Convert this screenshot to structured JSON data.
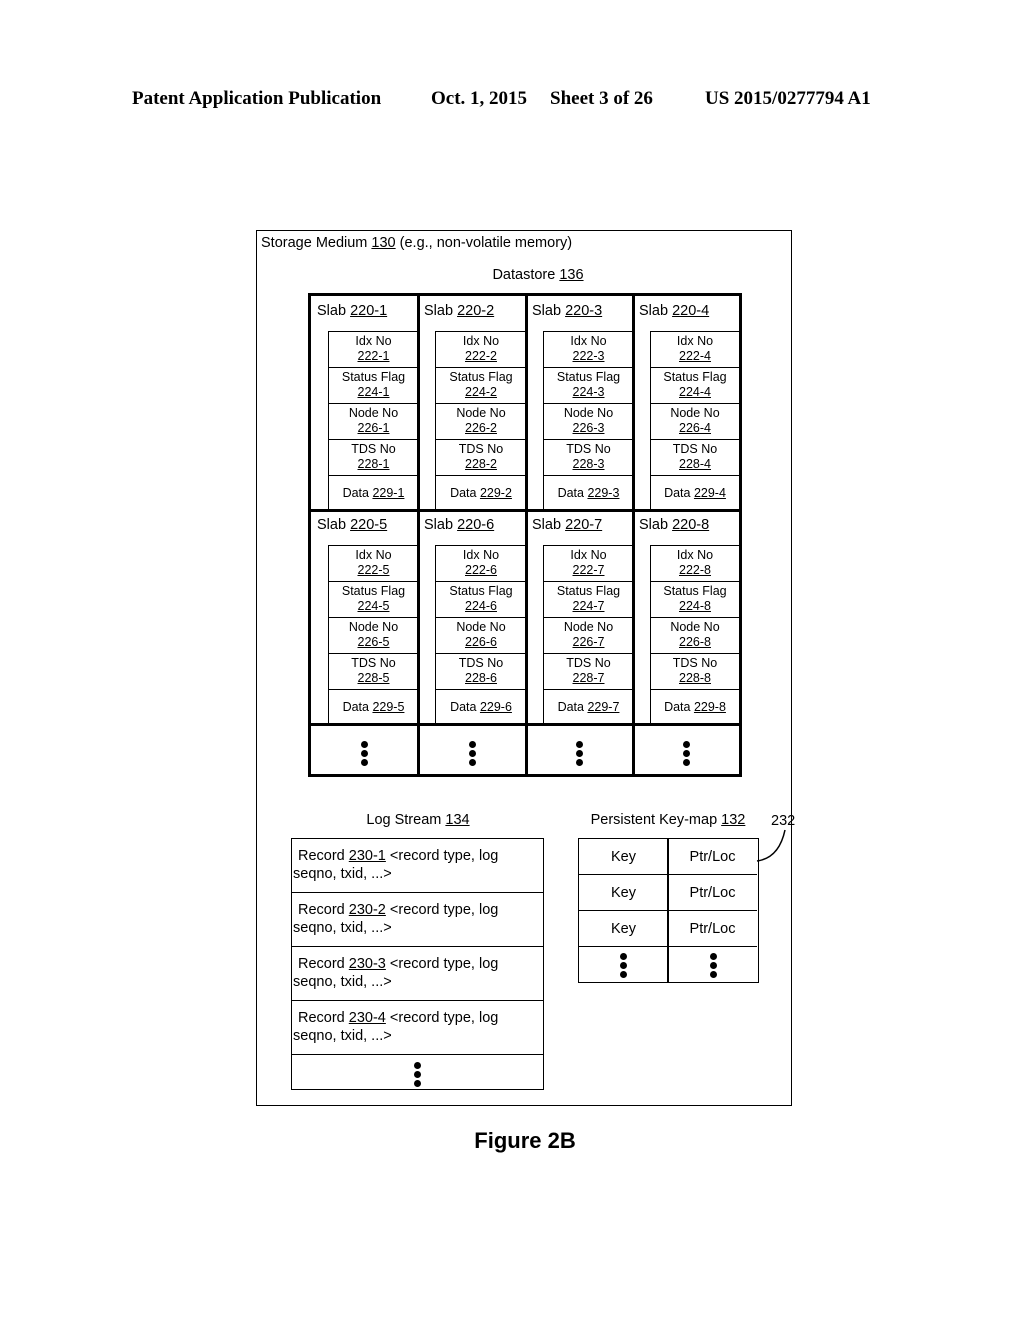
{
  "header": {
    "publication": "Patent Application Publication",
    "date": "Oct. 1, 2015",
    "sheet": "Sheet 3 of 26",
    "number": "US 2015/0277794 A1"
  },
  "storage": {
    "label": "Storage Medium",
    "ref": "130",
    "suffix": "(e.g., non-volatile memory)"
  },
  "datastore": {
    "label": "Datastore",
    "ref": "136"
  },
  "slabs": [
    {
      "label": "Slab",
      "ref": "220-1",
      "fields": [
        {
          "name": "Idx No",
          "ref": "222-1"
        },
        {
          "name": "Status Flag",
          "ref": "224-1"
        },
        {
          "name": "Node No",
          "ref": "226-1"
        },
        {
          "name": "TDS No",
          "ref": "228-1"
        }
      ],
      "data": {
        "name": "Data",
        "ref": "229-1"
      }
    },
    {
      "label": "Slab",
      "ref": "220-2",
      "fields": [
        {
          "name": "Idx No",
          "ref": "222-2"
        },
        {
          "name": "Status Flag",
          "ref": "224-2"
        },
        {
          "name": "Node No",
          "ref": "226-2"
        },
        {
          "name": "TDS No",
          "ref": "228-2"
        }
      ],
      "data": {
        "name": "Data",
        "ref": "229-2"
      }
    },
    {
      "label": "Slab",
      "ref": "220-3",
      "fields": [
        {
          "name": "Idx No",
          "ref": "222-3"
        },
        {
          "name": "Status Flag",
          "ref": "224-3"
        },
        {
          "name": "Node No",
          "ref": "226-3"
        },
        {
          "name": "TDS No",
          "ref": "228-3"
        }
      ],
      "data": {
        "name": "Data",
        "ref": "229-3"
      }
    },
    {
      "label": "Slab",
      "ref": "220-4",
      "fields": [
        {
          "name": "Idx No",
          "ref": "222-4"
        },
        {
          "name": "Status Flag",
          "ref": "224-4"
        },
        {
          "name": "Node No",
          "ref": "226-4"
        },
        {
          "name": "TDS No",
          "ref": "228-4"
        }
      ],
      "data": {
        "name": "Data",
        "ref": "229-4"
      }
    },
    {
      "label": "Slab",
      "ref": "220-5",
      "fields": [
        {
          "name": "Idx No",
          "ref": "222-5"
        },
        {
          "name": "Status Flag",
          "ref": "224-5"
        },
        {
          "name": "Node No",
          "ref": "226-5"
        },
        {
          "name": "TDS No",
          "ref": "228-5"
        }
      ],
      "data": {
        "name": "Data",
        "ref": "229-5"
      }
    },
    {
      "label": "Slab",
      "ref": "220-6",
      "fields": [
        {
          "name": "Idx No",
          "ref": "222-6"
        },
        {
          "name": "Status Flag",
          "ref": "224-6"
        },
        {
          "name": "Node No",
          "ref": "226-6"
        },
        {
          "name": "TDS No",
          "ref": "228-6"
        }
      ],
      "data": {
        "name": "Data",
        "ref": "229-6"
      }
    },
    {
      "label": "Slab",
      "ref": "220-7",
      "fields": [
        {
          "name": "Idx No",
          "ref": "222-7"
        },
        {
          "name": "Status Flag",
          "ref": "224-7"
        },
        {
          "name": "Node No",
          "ref": "226-7"
        },
        {
          "name": "TDS No",
          "ref": "228-7"
        }
      ],
      "data": {
        "name": "Data",
        "ref": "229-7"
      }
    },
    {
      "label": "Slab",
      "ref": "220-8",
      "fields": [
        {
          "name": "Idx No",
          "ref": "222-8"
        },
        {
          "name": "Status Flag",
          "ref": "224-8"
        },
        {
          "name": "Node No",
          "ref": "226-8"
        },
        {
          "name": "TDS No",
          "ref": "228-8"
        }
      ],
      "data": {
        "name": "Data",
        "ref": "229-8"
      }
    }
  ],
  "log_stream": {
    "label": "Log Stream",
    "ref": "134",
    "records": [
      {
        "label": "Record",
        "ref": "230-1",
        "desc": "<record type, log",
        "desc2": "seqno, txid, ...>"
      },
      {
        "label": "Record",
        "ref": "230-2",
        "desc": "<record type, log",
        "desc2": "seqno, txid, ...>"
      },
      {
        "label": "Record",
        "ref": "230-3",
        "desc": "<record type, log",
        "desc2": "seqno, txid, ...>"
      },
      {
        "label": "Record",
        "ref": "230-4",
        "desc": "<record type, log",
        "desc2": "seqno, txid, ...>"
      }
    ]
  },
  "keymap": {
    "label": "Persistent Key-map",
    "ref": "132",
    "callout": "232",
    "rows": [
      {
        "key": "Key",
        "value": "Ptr/Loc"
      },
      {
        "key": "Key",
        "value": "Ptr/Loc"
      },
      {
        "key": "Key",
        "value": "Ptr/Loc"
      }
    ]
  },
  "figure_label": "Figure 2B"
}
